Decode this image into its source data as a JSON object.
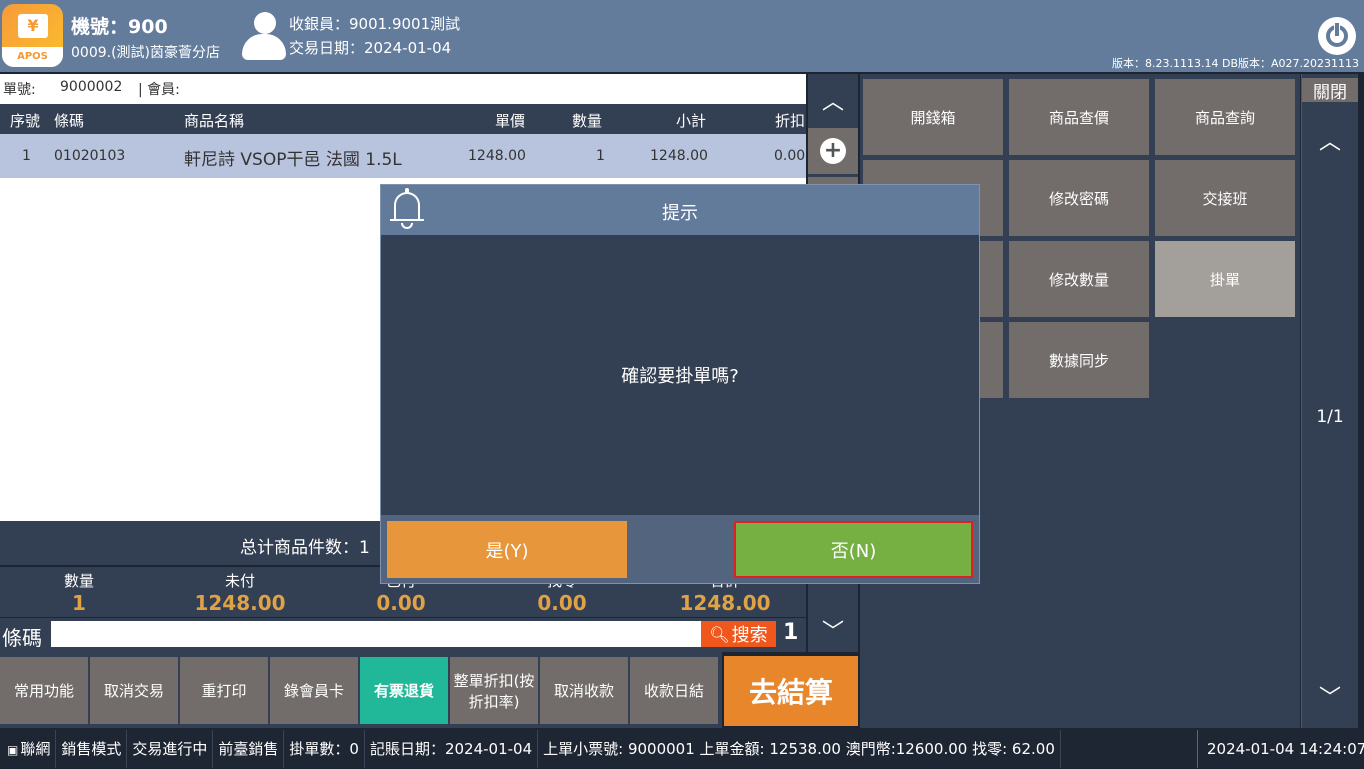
{
  "header": {
    "logo_text": "APOS",
    "machine": "機號：900",
    "store": "0009.(測試)茵豪薈分店",
    "cashier": "收銀員：9001.9001測試",
    "trade_date": "交易日期：2024-01-04",
    "version": "版本：8.23.1113.14 DB版本：A027.20231113"
  },
  "order": {
    "no_label": "單號:",
    "no_value": "9000002",
    "member_label": "| 會員:"
  },
  "table": {
    "headers": [
      "序號",
      "條碼",
      "商品名稱",
      "單價",
      "數量",
      "小計",
      "折扣"
    ],
    "rows": [
      [
        "1",
        "01020103",
        "軒尼詩 VSOP干邑 法國 1.5L",
        "1248.00",
        "1",
        "1248.00",
        "0.00"
      ]
    ]
  },
  "total_items": "总计商品件数：1",
  "summary": [
    {
      "label": "數量",
      "value": "1"
    },
    {
      "label": "未付",
      "value": "1248.00"
    },
    {
      "label": "已付",
      "value": "0.00"
    },
    {
      "label": "找零",
      "value": "0.00"
    },
    {
      "label": "合計",
      "value": "1248.00"
    }
  ],
  "barcode": {
    "label": "條碼",
    "value": "",
    "search": "搜索",
    "qty": "1"
  },
  "bottom_buttons": [
    "常用功能",
    "取消交易",
    "重打印",
    "錄會員卡",
    "有票退貨",
    "整單折扣(按折扣率)",
    "取消收款",
    "收款日結"
  ],
  "checkout": "去結算",
  "function_buttons": [
    "開錢箱",
    "商品查價",
    "商品查詢",
    "",
    "修改密碼",
    "交接班",
    "",
    "修改數量",
    "掛單",
    "",
    "數據同步"
  ],
  "right": {
    "close": "關閉",
    "page": "1/1"
  },
  "dialog": {
    "title": "提示",
    "message": "確認要掛單嗎?",
    "yes": "是(Y)",
    "no": "否(N)"
  },
  "statusbar": [
    "聯網",
    "銷售模式",
    "交易進行中",
    "前臺銷售",
    "掛單數：0",
    "記賬日期：2024-01-04",
    "上單小票號: 9000001 上單金額: 12538.00  澳門幣:12600.00 找零: 62.00"
  ],
  "datetime": "2024-01-04 14:24:07",
  "colors": {
    "header": "#647c9c",
    "accent_orange": "#e8862c",
    "return_green": "#21b89a",
    "yes": "#e8963c",
    "no": "#76b043"
  }
}
